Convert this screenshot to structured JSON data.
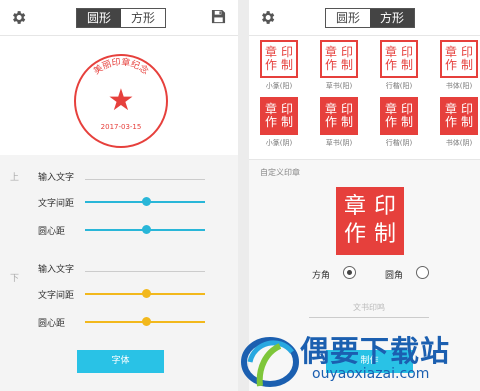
{
  "left": {
    "tabs": [
      "圆形",
      "方形"
    ],
    "stamp": {
      "top_text": "美丽印章纪念",
      "date": "2017-03-15",
      "star": "★",
      "color": "#e6403c"
    },
    "section_top": "上",
    "section_bottom": "下",
    "rows": [
      {
        "label": "输入文字"
      },
      {
        "label": "文字间距",
        "value": 0.52
      },
      {
        "label": "圆心距",
        "value": 0.52
      },
      {
        "label": "输入文字"
      },
      {
        "label": "文字间距",
        "value": 0.52
      },
      {
        "label": "圆心距",
        "value": 0.52
      }
    ],
    "font_button": "字体"
  },
  "right": {
    "tabs": [
      "圆形",
      "方形"
    ],
    "tiles": [
      {
        "chars": [
          "印",
          "章",
          "制",
          "作"
        ],
        "caption": "小篆(阳)"
      },
      {
        "chars": [
          "印",
          "章",
          "制",
          "作"
        ],
        "caption": "草书(阳)"
      },
      {
        "chars": [
          "印",
          "章",
          "制",
          "作"
        ],
        "caption": "行楷(阳)"
      },
      {
        "chars": [
          "印",
          "章",
          "制",
          "作"
        ],
        "caption": "书体(阳)"
      },
      {
        "chars": [
          "印",
          "章",
          "制",
          "作"
        ],
        "caption": "小篆(阴)"
      },
      {
        "chars": [
          "印",
          "章",
          "制",
          "作"
        ],
        "caption": "草书(阴)"
      },
      {
        "chars": [
          "印",
          "章",
          "制",
          "作"
        ],
        "caption": "行楷(阴)"
      },
      {
        "chars": [
          "印",
          "章",
          "制",
          "作"
        ],
        "caption": "书体(阴)"
      }
    ],
    "custom_title": "自定义印章",
    "big_stamp": [
      "印",
      "章",
      "制",
      "作"
    ],
    "option_square": "方角",
    "option_round": "圆角",
    "selected": "方角",
    "input_placeholder": "文书印鸣",
    "make_button": "制作"
  },
  "watermark": {
    "title": "偶要下载站",
    "url": "ouyaoxiazai.com"
  },
  "colors": {
    "accent": "#29c2e6",
    "stamp_red": "#e6403c",
    "slider_blue": "#29b6d8",
    "slider_yellow": "#f2b81c",
    "brand_blue": "#1b5fb0"
  }
}
